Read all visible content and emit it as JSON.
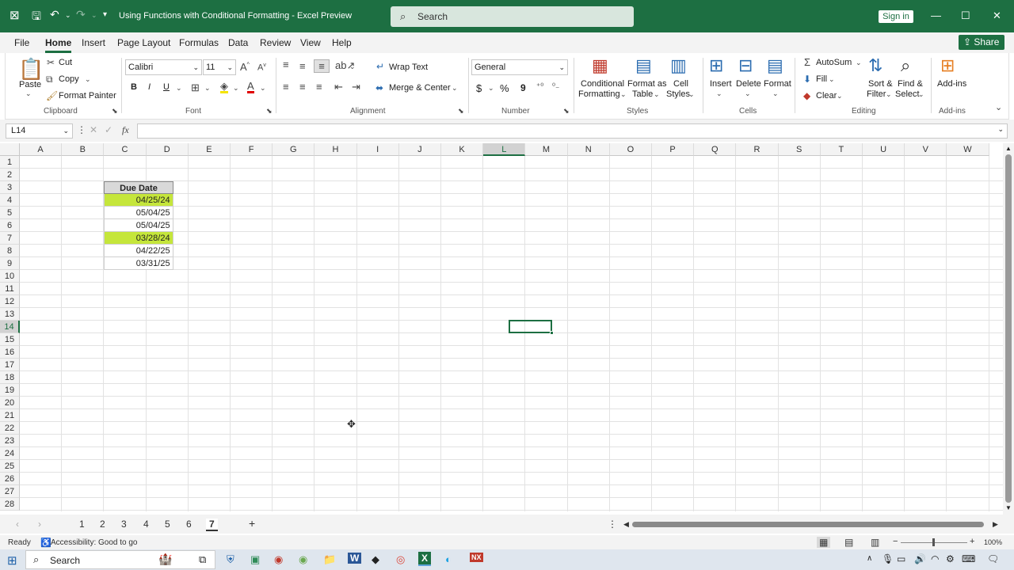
{
  "titlebar": {
    "doc_title": "Using Functions with Conditional Formatting  -  Excel Preview",
    "search_placeholder": "Search",
    "signin": "Sign in"
  },
  "menu": [
    "File",
    "Home",
    "Insert",
    "Page Layout",
    "Formulas",
    "Data",
    "Review",
    "View",
    "Help"
  ],
  "share": "Share",
  "ribbon": {
    "clipboard": {
      "paste": "Paste",
      "cut": "Cut",
      "copy": "Copy",
      "format_painter": "Format Painter",
      "label": "Clipboard"
    },
    "font": {
      "name": "Calibri",
      "size": "11",
      "bold": "B",
      "italic": "I",
      "underline": "U",
      "label": "Font"
    },
    "alignment": {
      "wrap": "Wrap Text",
      "merge": "Merge & Center",
      "label": "Alignment"
    },
    "number": {
      "format": "General",
      "currency": "$",
      "percent": "%",
      "comma": "9",
      "label": "Number"
    },
    "styles": {
      "cond1": "Conditional",
      "cond2": "Formatting",
      "fmt1": "Format as",
      "fmt2": "Table",
      "cell1": "Cell",
      "cell2": "Styles",
      "label": "Styles"
    },
    "cells": {
      "insert": "Insert",
      "delete": "Delete",
      "format": "Format",
      "label": "Cells"
    },
    "editing": {
      "autosum": "AutoSum",
      "fill": "Fill",
      "clear": "Clear",
      "sort1": "Sort &",
      "sort2": "Filter",
      "find1": "Find &",
      "find2": "Select",
      "label": "Editing"
    },
    "addins": {
      "btn": "Add-ins",
      "label": "Add-ins"
    }
  },
  "formula": {
    "namebox": "L14",
    "fx": "fx",
    "value": ""
  },
  "columns": [
    "A",
    "B",
    "C",
    "D",
    "E",
    "F",
    "G",
    "H",
    "I",
    "J",
    "K",
    "L",
    "M",
    "N",
    "O",
    "P",
    "Q",
    "R",
    "S",
    "T",
    "U",
    "V",
    "W"
  ],
  "rows": [
    "1",
    "2",
    "3",
    "4",
    "5",
    "6",
    "7",
    "8",
    "9",
    "10",
    "11",
    "12",
    "13",
    "14",
    "15",
    "16",
    "17",
    "18",
    "19",
    "20",
    "21",
    "22",
    "23",
    "24",
    "25",
    "26",
    "27",
    "28"
  ],
  "table": {
    "header": "Due Date",
    "values": [
      "04/25/24",
      "05/04/25",
      "05/04/25",
      "03/28/24",
      "04/22/25",
      "03/31/25"
    ],
    "highlighted": [
      true,
      false,
      false,
      true,
      false,
      false
    ],
    "highlight_color": "#c5e63b"
  },
  "sheets": [
    "1",
    "2",
    "3",
    "4",
    "5",
    "6",
    "7"
  ],
  "active_sheet": "7",
  "status": {
    "ready": "Ready",
    "accessibility": "Accessibility: Good to go",
    "zoom": "100%"
  },
  "taskbar": {
    "search": "Search"
  },
  "colors": {
    "brand": "#1d6f42",
    "accent": "#217346"
  }
}
